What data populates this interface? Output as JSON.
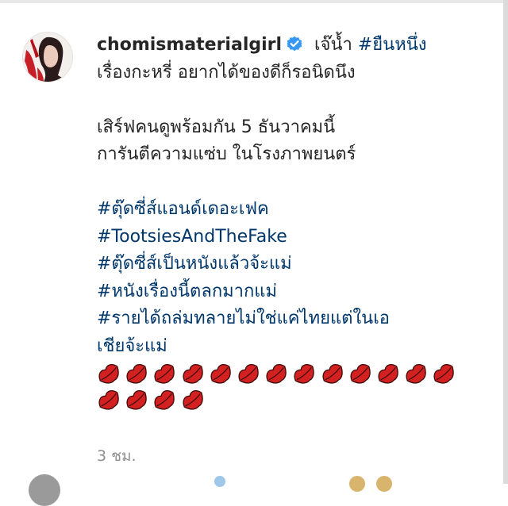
{
  "post": {
    "username": "chomismaterialgirl",
    "verified_icon": "verified-badge-icon",
    "caption_start": " เจ๊น้ำ ",
    "hashtag_first": "#ยืนหนึ่ง",
    "line2": "เรื่องกะหรี่ อยากได้ของดีก็รอนิดนึง",
    "line3": "เสิร์ฟคนดูพร้อมกัน 5 ธันวาคมนี้",
    "line4": "การันตีความแซ่บ ในโรงภาพยนตร์",
    "hashtags": [
      "#ตุ๊ดซี่ส์แอนด์เดอะเฟค",
      "#TootsiesAndTheFake",
      "#ตุ๊ดซี่ส์เป็นหนังแล้วจ้ะแม่",
      "#หนังเรื่องนี้ตลกมากแม่"
    ],
    "hashtag_last_line1": "#รายได้ถล่มทลายไม่ใช่แค่ไทยแต่ในเอ",
    "hashtag_last_line2": "เชียจ้ะแม่",
    "emoji_icon": "lips-emoji-icon",
    "emoji_count": 17,
    "timestamp": "3 ชม."
  },
  "colors": {
    "verified": "#3897f0",
    "hashtag": "#00376b",
    "lips": "#d32020"
  }
}
